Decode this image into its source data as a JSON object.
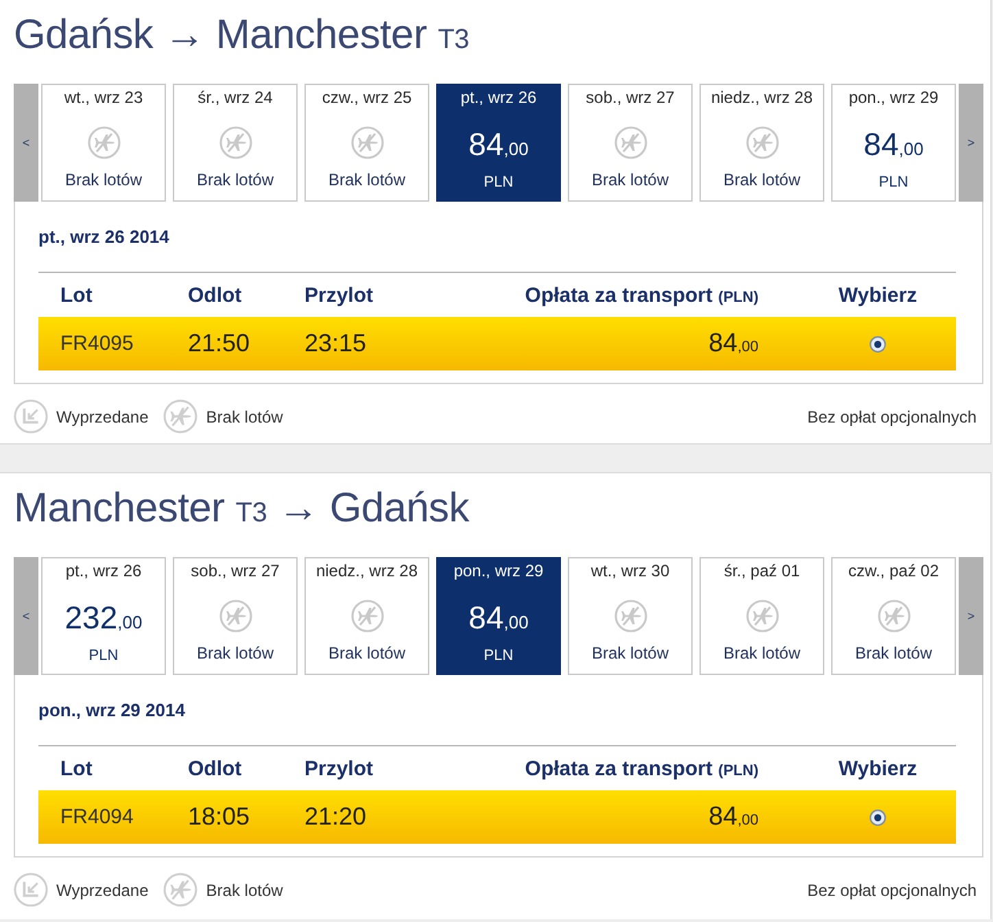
{
  "journeys": [
    {
      "title": [
        {
          "text": "Gdańsk",
          "kind": "place"
        },
        {
          "text": "→",
          "kind": "arrow"
        },
        {
          "text": "Manchester",
          "kind": "place"
        },
        {
          "text": "T3",
          "kind": "terminal"
        }
      ],
      "prev_button": "<",
      "next_button": ">",
      "days": [
        {
          "label": "wt., wrz 23",
          "kind": "no-flights",
          "status": "Brak lotów",
          "selected": false
        },
        {
          "label": "śr., wrz 24",
          "kind": "no-flights",
          "status": "Brak lotów",
          "selected": false
        },
        {
          "label": "czw., wrz 25",
          "kind": "no-flights",
          "status": "Brak lotów",
          "selected": false
        },
        {
          "label": "pt., wrz 26",
          "kind": "fare",
          "price": "84",
          "decimals": ",00",
          "currency": "PLN",
          "selected": true
        },
        {
          "label": "sob., wrz 27",
          "kind": "no-flights",
          "status": "Brak lotów",
          "selected": false
        },
        {
          "label": "niedz., wrz 28",
          "kind": "no-flights",
          "status": "Brak lotów",
          "selected": false
        },
        {
          "label": "pon., wrz 29",
          "kind": "fare",
          "price": "84",
          "decimals": ",00",
          "currency": "PLN",
          "selected": false
        }
      ],
      "selected_date": "pt., wrz 26 2014",
      "table": {
        "columns": [
          {
            "label": "Lot"
          },
          {
            "label": "Odlot"
          },
          {
            "label": "Przylot"
          },
          {
            "label": "Opłata za transport",
            "note": "(PLN)"
          },
          {
            "label": "Wybierz"
          }
        ],
        "rows": [
          {
            "flight": "FR4095",
            "departure": "21:50",
            "arrival": "23:15",
            "price": "84",
            "decimals": ",00",
            "selected": true
          }
        ]
      },
      "legend": [
        {
          "kind": "sold-out",
          "label": "Wyprzedane"
        },
        {
          "kind": "no-flights",
          "label": "Brak lotów"
        }
      ],
      "note": "Bez opłat opcjonalnych"
    },
    {
      "title": [
        {
          "text": "Manchester",
          "kind": "place"
        },
        {
          "text": "T3",
          "kind": "terminal"
        },
        {
          "text": "→",
          "kind": "arrow"
        },
        {
          "text": "Gdańsk",
          "kind": "place"
        }
      ],
      "prev_button": "<",
      "next_button": ">",
      "days": [
        {
          "label": "pt., wrz 26",
          "kind": "fare",
          "price": "232",
          "decimals": ",00",
          "currency": "PLN",
          "selected": false
        },
        {
          "label": "sob., wrz 27",
          "kind": "no-flights",
          "status": "Brak lotów",
          "selected": false
        },
        {
          "label": "niedz., wrz 28",
          "kind": "no-flights",
          "status": "Brak lotów",
          "selected": false
        },
        {
          "label": "pon., wrz 29",
          "kind": "fare",
          "price": "84",
          "decimals": ",00",
          "currency": "PLN",
          "selected": true
        },
        {
          "label": "wt., wrz 30",
          "kind": "no-flights",
          "status": "Brak lotów",
          "selected": false
        },
        {
          "label": "śr., paź 01",
          "kind": "no-flights",
          "status": "Brak lotów",
          "selected": false
        },
        {
          "label": "czw., paź 02",
          "kind": "no-flights",
          "status": "Brak lotów",
          "selected": false
        }
      ],
      "selected_date": "pon., wrz 29 2014",
      "table": {
        "columns": [
          {
            "label": "Lot"
          },
          {
            "label": "Odlot"
          },
          {
            "label": "Przylot"
          },
          {
            "label": "Opłata za transport",
            "note": "(PLN)"
          },
          {
            "label": "Wybierz"
          }
        ],
        "rows": [
          {
            "flight": "FR4094",
            "departure": "18:05",
            "arrival": "21:20",
            "price": "84",
            "decimals": ",00",
            "selected": true
          }
        ]
      },
      "legend": [
        {
          "kind": "sold-out",
          "label": "Wyprzedane"
        },
        {
          "kind": "no-flights",
          "label": "Brak lotów"
        }
      ],
      "note": "Bez opłat opcjonalnych"
    }
  ]
}
